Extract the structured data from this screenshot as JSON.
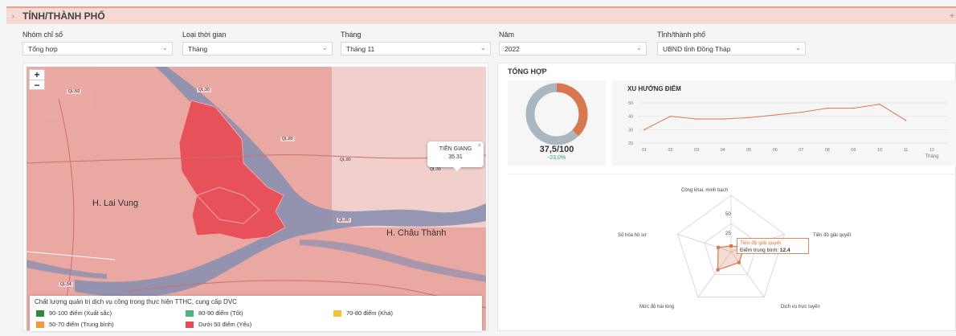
{
  "header": {
    "chevron_icon": "chevron-right-icon",
    "title": "TỈNH/THÀNH PHỐ",
    "right_mark": "+"
  },
  "filters": [
    {
      "label": "Nhóm chỉ số",
      "value": "Tổng hợp"
    },
    {
      "label": "Loại thời gian",
      "value": "Tháng"
    },
    {
      "label": "Tháng",
      "value": "Tháng 11"
    },
    {
      "label": "Năm",
      "value": "2022"
    },
    {
      "label": "Tỉnh/thành phố",
      "value": "UBND tỉnh Đồng Tháp"
    }
  ],
  "map": {
    "zoom_in": "+",
    "zoom_out": "−",
    "labels": {
      "lai_vung": "H. Lai Vung",
      "chau_thanh": "H. Châu Thành"
    },
    "road_labels": [
      "QL.30",
      "QL.N2",
      "QL.80",
      "QL.80",
      "QL.30",
      "QL.30",
      "QL.80",
      "QL.54",
      "QL.54"
    ],
    "popup": {
      "name": "TIỀN GIANG",
      "value": "35.31",
      "close": "×"
    },
    "legend": {
      "title": "Chất lượng quản trị dịch vụ công trong thực hiện TTHC, cung cấp DVC",
      "items": [
        {
          "label": "90-100 điểm (Xuất sắc)",
          "color": "#2e8b3e"
        },
        {
          "label": "80-90 điểm (Tốt)",
          "color": "#4fb37a"
        },
        {
          "label": "70-80 điểm (Khá)",
          "color": "#f0c23b"
        },
        {
          "label": "50-70 điểm (Trung bình)",
          "color": "#f09a3e"
        },
        {
          "label": "Dưới 50 điểm (Yếu)",
          "color": "#e8484e"
        }
      ]
    }
  },
  "summary": {
    "title": "TỔNG HỢP",
    "score": "37,5/100",
    "delta": "-23,0%",
    "score_fraction": 0.375,
    "colors": {
      "filled": "#d9784f",
      "remaining": "#a9b8c0"
    }
  },
  "trend": {
    "title": "XU HƯỚNG ĐIỂM",
    "x_title": "Tháng",
    "chart_data": {
      "type": "line",
      "categories": [
        "01",
        "02",
        "03",
        "04",
        "05",
        "06",
        "07",
        "08",
        "09",
        "10",
        "11",
        "12"
      ],
      "values": [
        30,
        40,
        38,
        38,
        39,
        41,
        43,
        46,
        46,
        49,
        37,
        null
      ],
      "ylim": [
        20,
        50
      ],
      "yticks": [
        "50",
        "40",
        "30",
        "20"
      ],
      "color": "#d9784f"
    }
  },
  "radar": {
    "axes": [
      "Công khai, minh bạch",
      "Tiến độ giải quyết",
      "Dịch vụ trực tuyến",
      "Mức độ hài lòng",
      "Số hóa hồ sơ"
    ],
    "ticks": [
      "50",
      "25"
    ],
    "values": [
      5,
      12.4,
      12,
      20,
      12
    ],
    "max": 50,
    "tooltip": {
      "title": "Tiến độ giải quyết",
      "label": "Điểm trung bình:",
      "value": "12.4"
    },
    "color": "#d9784f"
  }
}
